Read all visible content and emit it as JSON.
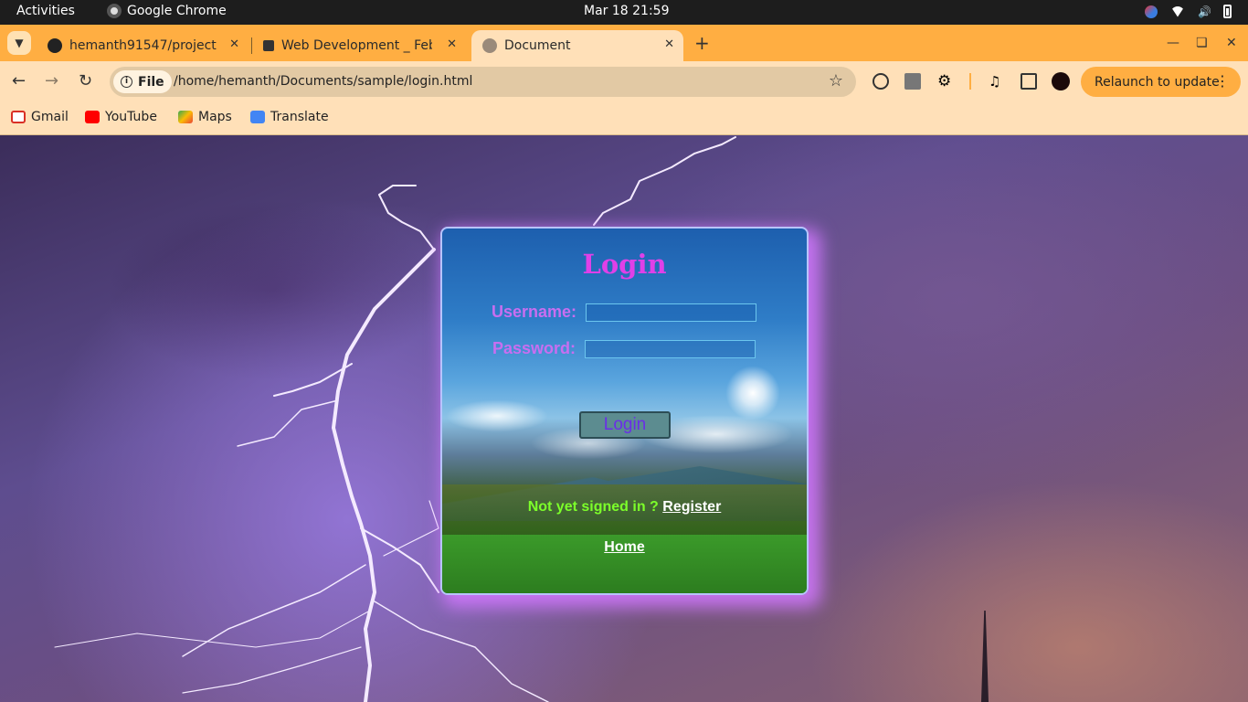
{
  "system": {
    "activities": "Activities",
    "app_name": "Google Chrome",
    "clock": "Mar 18  21:59"
  },
  "tabs": [
    {
      "title": "hemanth91547/project",
      "icon": "github-icon",
      "active": false
    },
    {
      "title": "Web Development _ Feb",
      "icon": "doc-icon",
      "active": false
    },
    {
      "title": "Document",
      "icon": "globe-icon",
      "active": true
    }
  ],
  "toolbar": {
    "site_chip": "File",
    "url": "/home/hemanth/Documents/sample/login.html",
    "relaunch_label": "Relaunch to update"
  },
  "bookmarks": [
    {
      "label": "Gmail",
      "icon": "gmail-icon",
      "color": "#d93025"
    },
    {
      "label": "YouTube",
      "icon": "youtube-icon",
      "color": "#ff0000"
    },
    {
      "label": "Maps",
      "icon": "maps-icon",
      "color": "#34a853"
    },
    {
      "label": "Translate",
      "icon": "translate-icon",
      "color": "#4285f4"
    }
  ],
  "login": {
    "title": "Login",
    "username_label": "Username:",
    "password_label": "Password:",
    "username_value": "",
    "password_value": "",
    "button_label": "Login",
    "register_prompt": "Not yet signed in ?",
    "register_link": "Register",
    "home_link": "Home"
  },
  "colors": {
    "tabstrip": "#ffae42",
    "toolbar": "#ffe0b8",
    "title_magenta": "#e040e8",
    "label_violet": "#c86ef0",
    "prompt_green": "#7cff2a"
  }
}
